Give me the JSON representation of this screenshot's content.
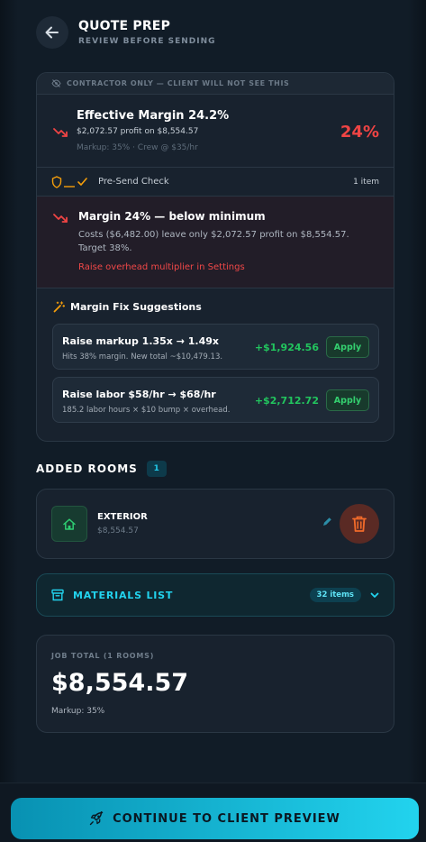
{
  "header": {
    "title": "QUOTE PREP",
    "subtitle": "REVIEW BEFORE SENDING"
  },
  "contractor_panel": {
    "banner": "CONTRACTOR ONLY — CLIENT WILL NOT SEE THIS",
    "margin": {
      "title": "Effective Margin 24.2%",
      "profit_line": "$2,072.57 profit on $8,554.57",
      "meta": "Markup: 35% · Crew @ $35/hr",
      "percent": "24%"
    },
    "presend": {
      "label": "Pre-Send Check",
      "count": "1 item"
    },
    "alert": {
      "title": "Margin 24% — below minimum",
      "text": "Costs ($6,482.00) leave only $2,072.57 profit on $8,554.57. Target 38%.",
      "action": "Raise overhead multiplier in Settings"
    },
    "suggestions": {
      "heading": "Margin Fix Suggestions",
      "items": [
        {
          "title": "Raise markup 1.35x → 1.49x",
          "desc": "Hits 38% margin. New total ~$10,479.13.",
          "amount": "+$1,924.56",
          "button": "Apply"
        },
        {
          "title": "Raise labor $58/hr → $68/hr",
          "desc": "185.2 labor hours × $10 bump × overhead.",
          "amount": "+$2,712.72",
          "button": "Apply"
        }
      ]
    }
  },
  "rooms": {
    "heading": "ADDED ROOMS",
    "count": "1",
    "items": [
      {
        "name": "EXTERIOR",
        "price": "$8,554.57",
        "icon": "home-icon"
      }
    ]
  },
  "materials": {
    "label": "MATERIALS LIST",
    "count": "32 items"
  },
  "total": {
    "label": "JOB TOTAL (1 ROOMS)",
    "value": "$8,554.57",
    "meta": "Markup: 35%"
  },
  "cta": {
    "label": "CONTINUE TO CLIENT PREVIEW"
  },
  "colors": {
    "accent": "#22d3ee",
    "danger": "#ef4444",
    "success": "#22c55e",
    "warning": "#f59e0b"
  }
}
